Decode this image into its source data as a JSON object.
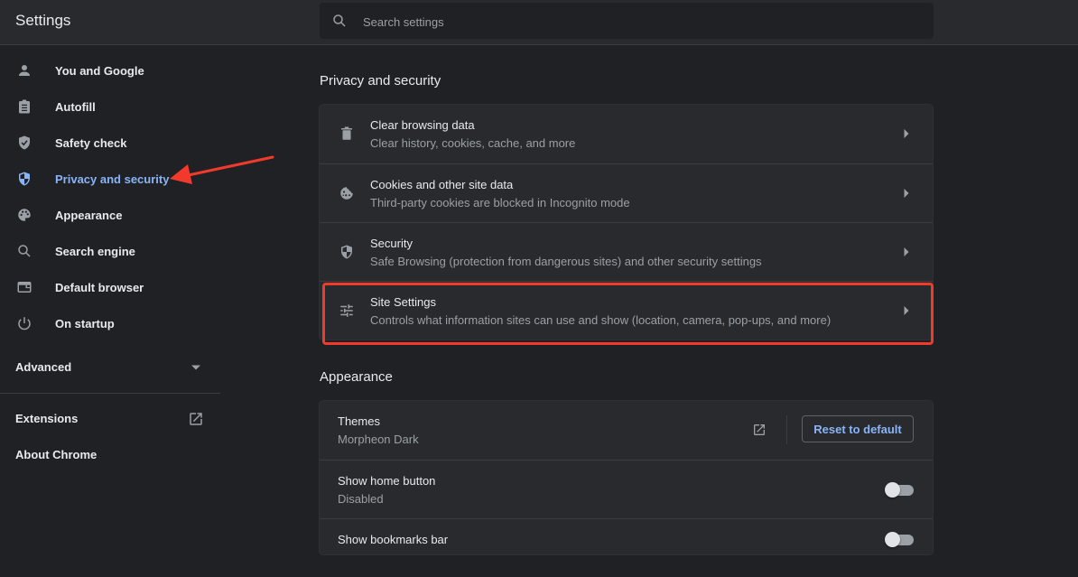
{
  "header": {
    "title": "Settings",
    "search_placeholder": "Search settings",
    "search_value": ""
  },
  "sidebar": {
    "items": [
      {
        "label": "You and Google",
        "icon": "person-icon",
        "active": false
      },
      {
        "label": "Autofill",
        "icon": "clipboard-icon",
        "active": false
      },
      {
        "label": "Safety check",
        "icon": "shield-check-icon",
        "active": false
      },
      {
        "label": "Privacy and security",
        "icon": "shield-half-icon",
        "active": true
      },
      {
        "label": "Appearance",
        "icon": "palette-icon",
        "active": false
      },
      {
        "label": "Search engine",
        "icon": "search-icon",
        "active": false
      },
      {
        "label": "Default browser",
        "icon": "browser-window-icon",
        "active": false
      },
      {
        "label": "On startup",
        "icon": "power-icon",
        "active": false
      }
    ],
    "advanced_label": "Advanced",
    "extensions_label": "Extensions",
    "about_label": "About Chrome"
  },
  "privacy": {
    "title": "Privacy and security",
    "rows": [
      {
        "title": "Clear browsing data",
        "subtitle": "Clear history, cookies, cache, and more",
        "icon": "trash-icon"
      },
      {
        "title": "Cookies and other site data",
        "subtitle": "Third-party cookies are blocked in Incognito mode",
        "icon": "cookie-icon"
      },
      {
        "title": "Security",
        "subtitle": "Safe Browsing (protection from dangerous sites) and other security settings",
        "icon": "shield-half-icon"
      },
      {
        "title": "Site Settings",
        "subtitle": "Controls what information sites can use and show (location, camera, pop-ups, and more)",
        "icon": "tune-sliders-icon",
        "highlighted": true
      }
    ]
  },
  "appearance": {
    "title": "Appearance",
    "themes": {
      "title": "Themes",
      "value": "Morpheon Dark",
      "reset_label": "Reset to default"
    },
    "home_button": {
      "title": "Show home button",
      "status": "Disabled",
      "enabled": false
    },
    "bookmarks_bar": {
      "title": "Show bookmarks bar",
      "enabled": false
    }
  },
  "colors": {
    "accent": "#8ab4f8",
    "annotation": "#f23a2c",
    "background": "#202124",
    "card": "#292a2d"
  }
}
